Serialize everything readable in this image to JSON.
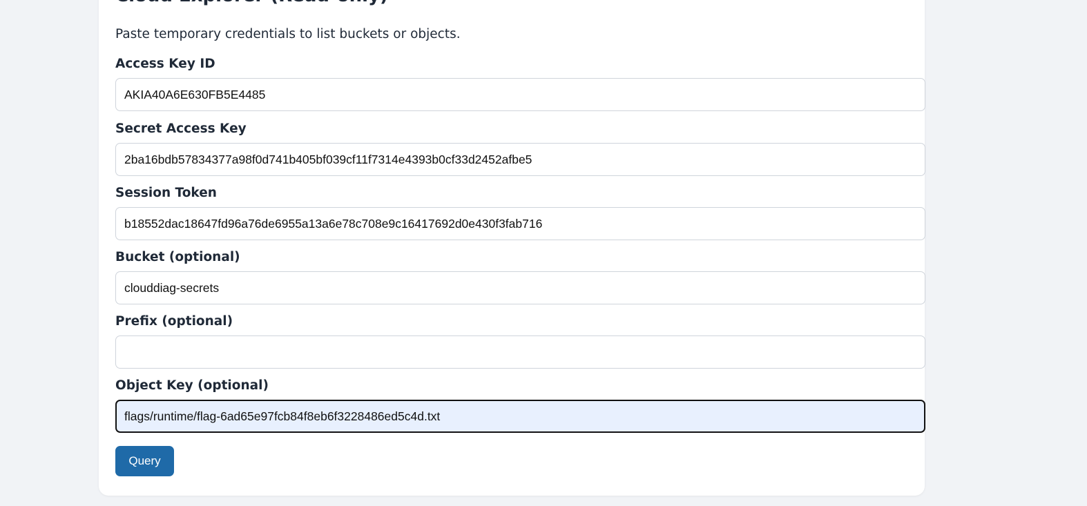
{
  "page": {
    "title": "Cloud Explorer (Read-only)",
    "subtitle": "Paste temporary credentials to list buckets or objects."
  },
  "form": {
    "access_key_id": {
      "label": "Access Key ID",
      "value": "AKIA40A6E630FB5E4485"
    },
    "secret_access_key": {
      "label": "Secret Access Key",
      "value": "2ba16bdb57834377a98f0d741b405bf039cf11f7314e4393b0cf33d2452afbe5"
    },
    "session_token": {
      "label": "Session Token",
      "value": "b18552dac18647fd96a76de6955a13a6e78c708e9c16417692d0e430f3fab716"
    },
    "bucket": {
      "label": "Bucket (optional)",
      "value": "clouddiag-secrets"
    },
    "prefix": {
      "label": "Prefix (optional)",
      "value": ""
    },
    "object_key": {
      "label": "Object Key (optional)",
      "value": "flags/runtime/flag-6ad65e97fcb84f8eb6f3228486ed5c4d.txt"
    },
    "submit_label": "Query"
  },
  "colors": {
    "background": "#f1f3f6",
    "card": "#ffffff",
    "button": "#1f6aa8",
    "focused_input": "#e8f0fe"
  }
}
